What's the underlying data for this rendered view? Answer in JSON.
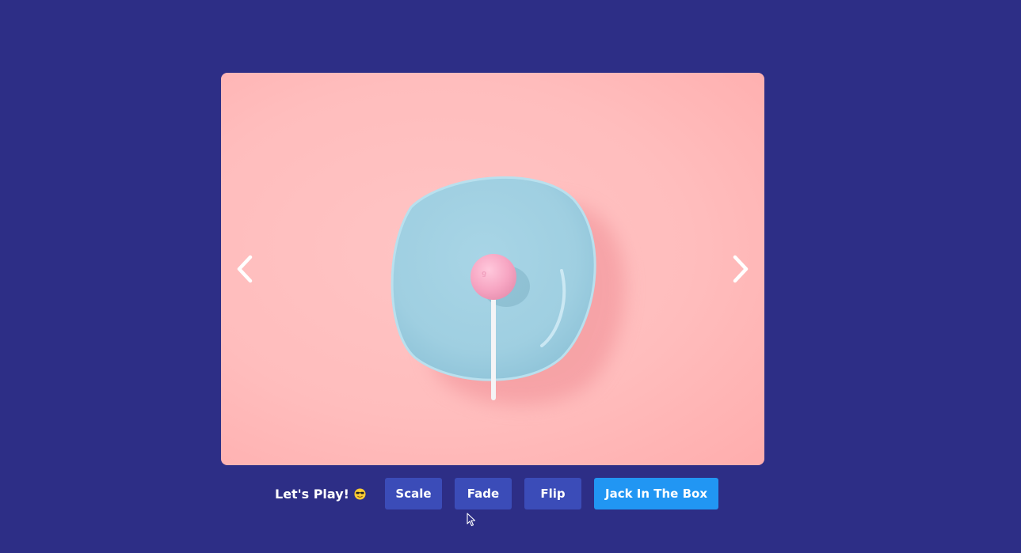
{
  "slider": {
    "image_alt": "Pink lollipop on a light blue plate against a pink background",
    "prev_icon": "chevron-left-icon",
    "next_icon": "chevron-right-icon"
  },
  "controls": {
    "label": "Let's Play!",
    "emoji_icon": "sunglasses-emoji-icon",
    "buttons": [
      {
        "label": "Scale",
        "active": false
      },
      {
        "label": "Fade",
        "active": false
      },
      {
        "label": "Flip",
        "active": false
      },
      {
        "label": "Jack In The Box",
        "active": true
      }
    ]
  },
  "colors": {
    "background": "#2d2e86",
    "button": "#3b4cb8",
    "button_active": "#2196f3",
    "text": "#ffffff"
  }
}
